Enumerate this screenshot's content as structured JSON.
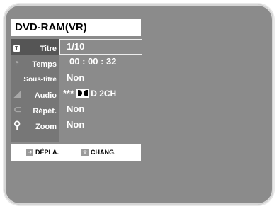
{
  "title": "DVD-RAM(VR)",
  "menu": [
    {
      "label": "Titre",
      "icon": "title-icon",
      "value": "1/10",
      "selected": true
    },
    {
      "label": "Temps",
      "icon": "time-icon",
      "value": "00 : 00 : 32"
    },
    {
      "label": "Sous-titre",
      "icon": "subtitle-icon",
      "value": "Non"
    },
    {
      "label": "Audio",
      "icon": "audio-icon",
      "value_prefix": "***",
      "value_suffix": "D 2CH"
    },
    {
      "label": "Répét.",
      "icon": "repeat-icon",
      "value": "Non"
    },
    {
      "label": "Zoom",
      "icon": "zoom-icon",
      "value": "Non"
    }
  ],
  "help": {
    "move_label": "DÉPLA.",
    "change_label": "CHANG."
  },
  "title_icon_letter": "T",
  "colors": {
    "background": "#8b8b8b",
    "menu_column": "#777777",
    "selected_row": "#555555",
    "text": "#ffffff",
    "bar": "#ffffff"
  }
}
